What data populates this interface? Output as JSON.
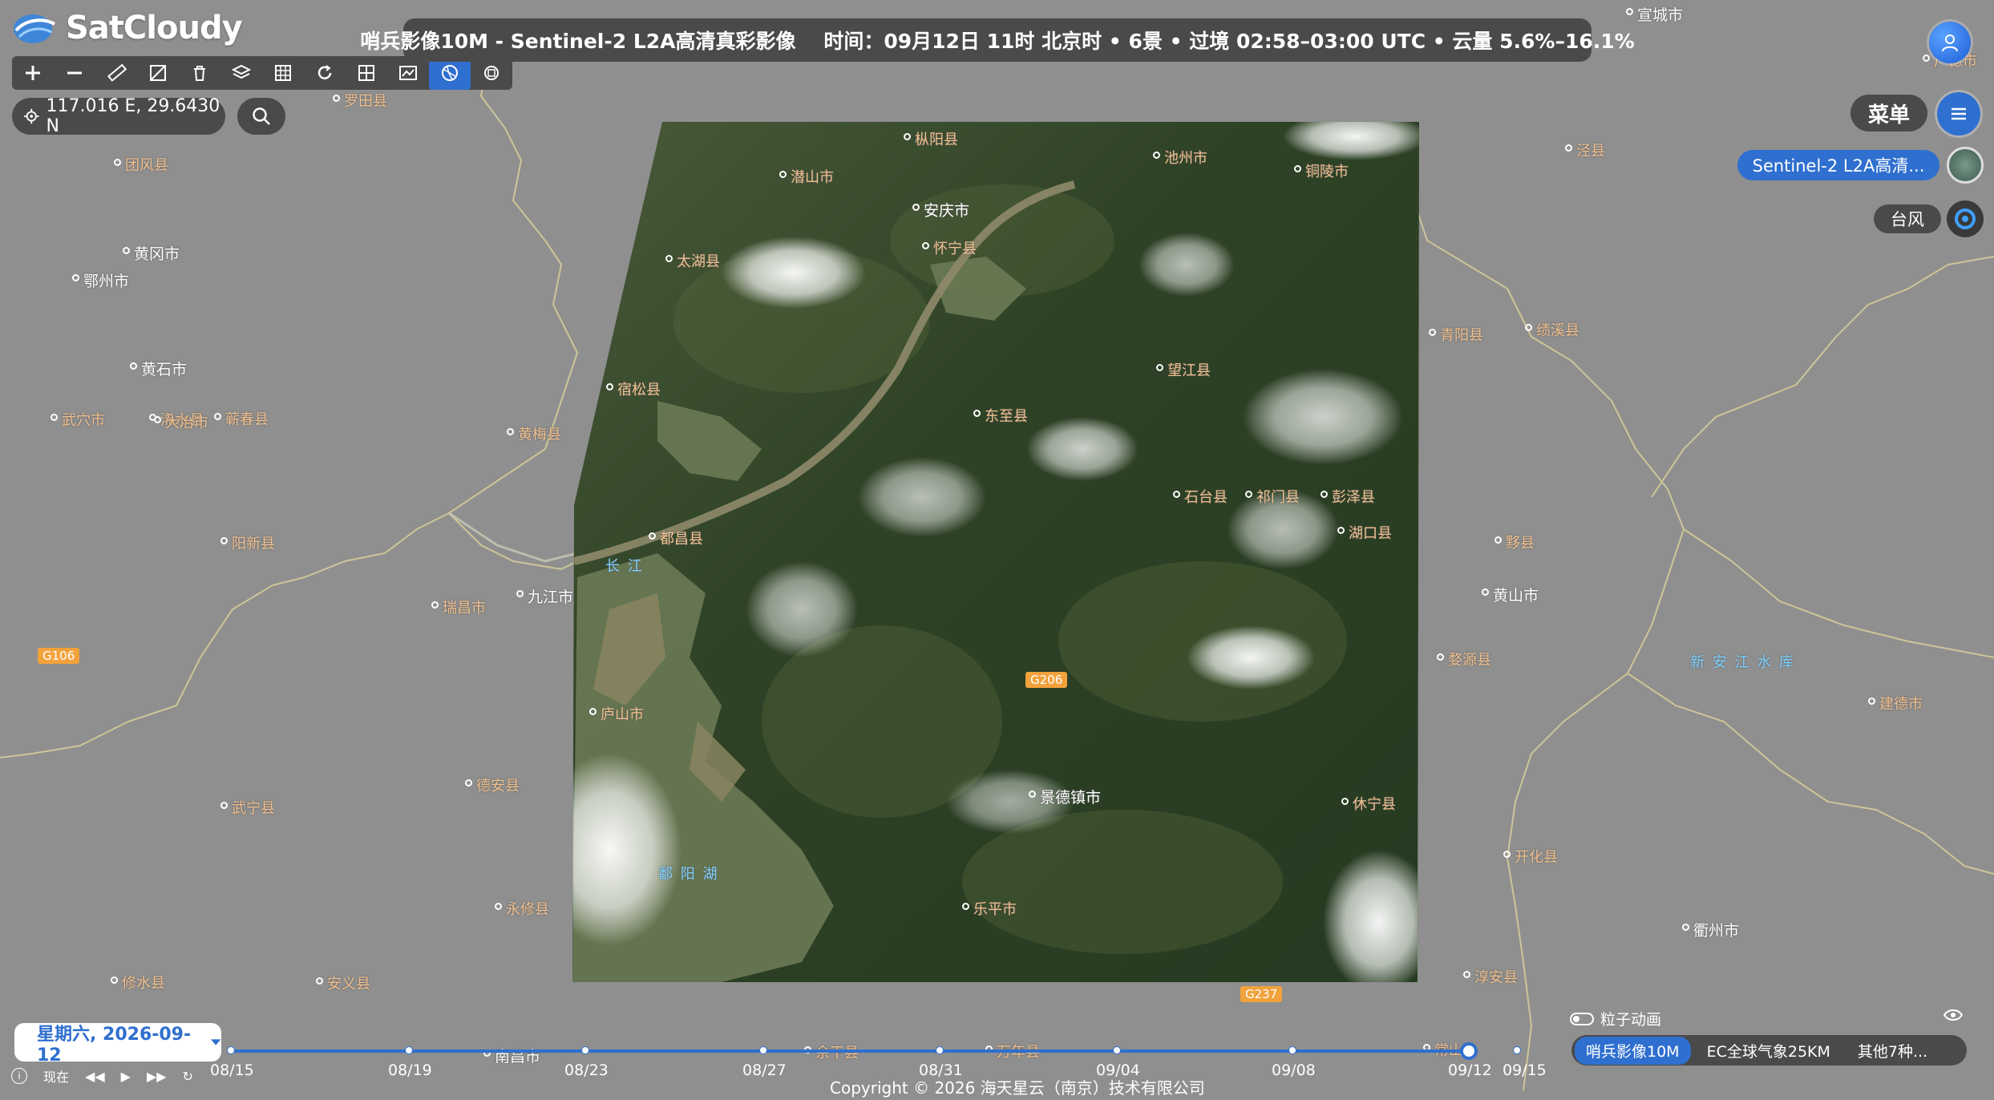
{
  "app": {
    "name": "SatCloudy"
  },
  "toolbar": {
    "buttons": [
      {
        "icon": "zoom-in-icon"
      },
      {
        "icon": "zoom-out-icon"
      },
      {
        "icon": "ruler-icon"
      },
      {
        "icon": "area-measure-icon"
      },
      {
        "icon": "trash-icon"
      },
      {
        "icon": "layers-icon"
      },
      {
        "icon": "grid-icon"
      },
      {
        "icon": "refresh-icon"
      },
      {
        "icon": "graticule-icon"
      },
      {
        "icon": "chart-icon"
      },
      {
        "icon": "globe-icon",
        "active": true
      },
      {
        "icon": "compare-icon"
      }
    ]
  },
  "coordinate": {
    "text": "117.016 E, 29.6430 N"
  },
  "info_bar": {
    "text": "哨兵影像10M - Sentinel-2 L2A高清真彩影像    时间：09月12日 11时 北京时 • 6景 • 过境 02:58–03:00 UTC • 云量 5.6%–16.1%"
  },
  "right_panel": {
    "menu_label": "菜单",
    "layer_chip": "Sentinel-2 L2A高清...",
    "typhoon_label": "台风"
  },
  "timeline": {
    "date": "星期六, 2026-09-12",
    "ticks": [
      "08/15",
      "08/19",
      "08/23",
      "08/27",
      "08/31",
      "09/04",
      "09/08",
      "09/12",
      "09/15"
    ],
    "now_label": "现在"
  },
  "particle_label": "粒子动画",
  "layer_tabs": [
    "哨兵影像10M",
    "EC全球气象25KM",
    "其他7种..."
  ],
  "copyright": "Copyright © 2026 海天星云（南京）技术有限公司",
  "map_labels": [
    {
      "text": "宣城市",
      "kind": "city"
    },
    {
      "text": "广德市",
      "kind": "county"
    },
    {
      "text": "罗田县",
      "kind": "county"
    },
    {
      "text": "团风县",
      "kind": "county"
    },
    {
      "text": "黄冈市",
      "kind": "city"
    },
    {
      "text": "鄂州市",
      "kind": "city"
    },
    {
      "text": "黄石市",
      "kind": "city"
    },
    {
      "text": "浠水县",
      "kind": "county"
    },
    {
      "text": "蕲春县",
      "kind": "county"
    },
    {
      "text": "阳新县",
      "kind": "county"
    },
    {
      "text": "大冶市",
      "kind": "county"
    },
    {
      "text": "武穴市",
      "kind": "county"
    },
    {
      "text": "黄梅县",
      "kind": "county"
    },
    {
      "text": "九江市",
      "kind": "city"
    },
    {
      "text": "瑞昌市",
      "kind": "county"
    },
    {
      "text": "德安县",
      "kind": "county"
    },
    {
      "text": "武宁县",
      "kind": "county"
    },
    {
      "text": "永修县",
      "kind": "county"
    },
    {
      "text": "安义县",
      "kind": "county"
    },
    {
      "text": "修水县",
      "kind": "county"
    },
    {
      "text": "枞阳县",
      "kind": "county"
    },
    {
      "text": "池州市",
      "kind": "county"
    },
    {
      "text": "铜陵市",
      "kind": "county"
    },
    {
      "text": "潜山市",
      "kind": "county"
    },
    {
      "text": "安庆市",
      "kind": "city"
    },
    {
      "text": "怀宁县",
      "kind": "county"
    },
    {
      "text": "太湖县",
      "kind": "county"
    },
    {
      "text": "宿松县",
      "kind": "county"
    },
    {
      "text": "望江县",
      "kind": "county"
    },
    {
      "text": "东至县",
      "kind": "county"
    },
    {
      "text": "石台县",
      "kind": "county"
    },
    {
      "text": "彭泽县",
      "kind": "county"
    },
    {
      "text": "湖口县",
      "kind": "county"
    },
    {
      "text": "都昌县",
      "kind": "county"
    },
    {
      "text": "庐山市",
      "kind": "county"
    },
    {
      "text": "景德镇市",
      "kind": "city"
    },
    {
      "text": "祁门县",
      "kind": "county"
    },
    {
      "text": "黟县",
      "kind": "county"
    },
    {
      "text": "黄山市",
      "kind": "city"
    },
    {
      "text": "休宁县",
      "kind": "county"
    },
    {
      "text": "婺源县",
      "kind": "county"
    },
    {
      "text": "乐平市",
      "kind": "county"
    },
    {
      "text": "余干县",
      "kind": "county"
    },
    {
      "text": "万年县",
      "kind": "county"
    },
    {
      "text": "南昌市",
      "kind": "city"
    },
    {
      "text": "开化县",
      "kind": "county"
    },
    {
      "text": "衢州市",
      "kind": "city"
    },
    {
      "text": "常山县",
      "kind": "county"
    },
    {
      "text": "淳安县",
      "kind": "county"
    },
    {
      "text": "建德市",
      "kind": "county"
    },
    {
      "text": "绩溪县",
      "kind": "county"
    },
    {
      "text": "泾县",
      "kind": "county"
    },
    {
      "text": "青阳县",
      "kind": "county"
    },
    {
      "text": "长 江",
      "kind": "water"
    },
    {
      "text": "鄱 阳 湖",
      "kind": "water"
    },
    {
      "text": "新 安 江 水 库",
      "kind": "water"
    },
    {
      "text": "G106",
      "kind": "road"
    },
    {
      "text": "G206",
      "kind": "road"
    },
    {
      "text": "G237",
      "kind": "road"
    }
  ]
}
